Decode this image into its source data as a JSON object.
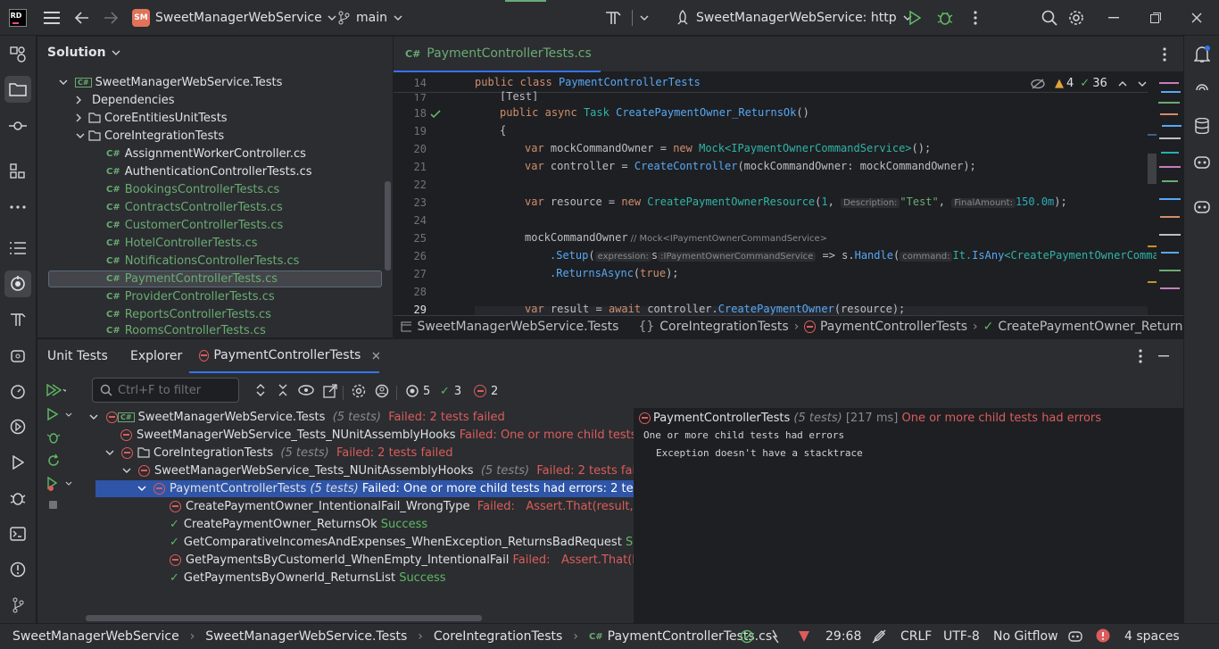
{
  "titlebar": {
    "logo": "RD",
    "project_badge": "SM",
    "project_name": "SweetManagerWebService",
    "branch": "main",
    "run_config": "SweetManagerWebService: http"
  },
  "solution": {
    "header": "Solution",
    "items": [
      {
        "label": "SweetManagerWebService.Tests",
        "lang": "C#"
      },
      {
        "label": "Dependencies"
      },
      {
        "label": "CoreEntitiesUnitTests"
      },
      {
        "label": "CoreIntegrationTests"
      },
      {
        "label": "AssignmentWorkerController.cs",
        "lang": "C#"
      },
      {
        "label": "AuthenticationControllerTests.cs",
        "lang": "C#"
      },
      {
        "label": "BookingsControllerTests.cs",
        "lang": "C#"
      },
      {
        "label": "ContractsControllerTests.cs",
        "lang": "C#"
      },
      {
        "label": "CustomerControllerTests.cs",
        "lang": "C#"
      },
      {
        "label": "HotelControllerTests.cs",
        "lang": "C#"
      },
      {
        "label": "NotificationsControllerTests.cs",
        "lang": "C#"
      },
      {
        "label": "PaymentControllerTests.cs",
        "lang": "C#"
      },
      {
        "label": "ProviderControllerTests.cs",
        "lang": "C#"
      },
      {
        "label": "ReportsControllerTests.cs",
        "lang": "C#"
      },
      {
        "label": "RoomsControllerTests.cs",
        "lang": "C#"
      }
    ]
  },
  "editor": {
    "tab_lang": "C#",
    "tab_label": "PaymentControllerTests.cs",
    "warnings": "4",
    "checks": "36",
    "sticky_line": "14",
    "lines": [
      "17",
      "18",
      "19",
      "20",
      "21",
      "22",
      "23",
      "24",
      "25",
      "26",
      "27",
      "28",
      "29"
    ],
    "code": {
      "sticky_public": "public",
      "sticky_class": "class",
      "sticky_name": "PaymentControllerTests",
      "l17": "[Test]",
      "l18_a": "public",
      "l18_b": "async",
      "l18_c": "Task",
      "l18_d": "CreatePaymentOwner_ReturnsOk",
      "l18_e": "()",
      "l19": "{",
      "l20_var": "var",
      "l20_name": " mockCommandOwner = ",
      "l20_new": "new",
      "l20_mock": " Mock",
      "l20_type": "<IPaymentOwnerCommandService>",
      "l20_end": "();",
      "l21_var": "var",
      "l21_name": " controller = ",
      "l21_fn": "CreateController",
      "l21_hint": "mockCommandOwner:",
      "l21_end": "mockCommandOwner);",
      "l23_var": "var",
      "l23_name": " resource = ",
      "l23_new": "new",
      "l23_type": " CreatePaymentOwnerResource",
      "l23_num1": "1",
      "l23_hint1": "Description:",
      "l23_str": "\"Test\"",
      "l23_hint2": "FinalAmount:",
      "l23_num2": "150.0m",
      "l23_end": ");",
      "l25_name": "mockCommandOwner",
      "l25_hint": "// Mock<IPaymentOwnerCommandService>",
      "l26_fn": ".Setup",
      "l26_hint1": "expression:",
      "l26_s": "s",
      "l26_hint2": ":IPaymentOwnerCommandService",
      "l26_arrow": " => s.",
      "l26_fn2": "Handle",
      "l26_hint3": "command:",
      "l26_it": "It.",
      "l26_isany": "IsAny",
      "l26_type": "<CreatePaymentOwnerCommand>",
      "l27_fn": ".ReturnsAsync",
      "l27_true": "true",
      "l27_end": ");",
      "l29_var": "var",
      "l29_name": " result = ",
      "l29_await": "await",
      "l29_ctrl": " controller.",
      "l29_fn": "CreatePaymentOwner",
      "l29_end": "(resource);"
    },
    "breadcrumb": [
      "SweetManagerWebService.Tests",
      "CoreIntegrationTests",
      "PaymentControllerTests",
      "CreatePaymentOwner_ReturnsOk"
    ]
  },
  "unit_tests": {
    "title": "Unit Tests",
    "tab_explorer": "Explorer",
    "tab_session": "PaymentControllerTests",
    "filter_placeholder": "Ctrl+F to filter",
    "count_total": "5",
    "count_passed": "3",
    "count_failed": "2",
    "tree": [
      {
        "name": "SweetManagerWebService.Tests",
        "lang": "C#",
        "meta": "(5 tests)",
        "status": "Failed: 2 tests failed"
      },
      {
        "name": "SweetManagerWebService_Tests_NUnitAssemblyHooks",
        "status": "Failed: One or more child tests h"
      },
      {
        "name": "CoreIntegrationTests",
        "meta": "(5 tests)",
        "status": "Failed: 2 tests failed"
      },
      {
        "name": "SweetManagerWebService_Tests_NUnitAssemblyHooks",
        "meta": "(5 tests)",
        "status": "Failed: 2 tests failed"
      },
      {
        "name": "PaymentControllerTests",
        "meta": "(5 tests)",
        "status": "Failed: One or more child tests had errors: 2 tests"
      },
      {
        "name": "CreatePaymentOwner_IntentionalFail_WrongType",
        "status": "Failed:",
        "detail": "Assert.That(result, Is."
      },
      {
        "name": "CreatePaymentOwner_ReturnsOk",
        "status": "Success"
      },
      {
        "name": "GetComparativeIncomesAndExpenses_WhenException_ReturnsBadRequest",
        "status": "Succ"
      },
      {
        "name": "GetPaymentsByCustomerId_WhenEmpty_IntentionalFail",
        "status": "Failed:",
        "detail": "Assert.That(list."
      },
      {
        "name": "GetPaymentsByOwnerId_ReturnsList",
        "status": "Success"
      }
    ],
    "detail": {
      "name": "PaymentControllerTests",
      "meta": "(5 tests)",
      "time": "[217 ms]",
      "status": "One or more child tests had errors",
      "line1": "One or more child tests had errors",
      "line2": "Exception doesn't have a stacktrace"
    }
  },
  "statusbar": {
    "crumbs": [
      "SweetManagerWebService",
      "SweetManagerWebService.Tests",
      "CoreIntegrationTests"
    ],
    "file_lang": "C#",
    "file": "PaymentControllerTests.cs",
    "position": "29:68",
    "line_ending": "CRLF",
    "encoding": "UTF-8",
    "vcs": "No Gitflow",
    "indent": "4 spaces"
  },
  "colors": {
    "accent": "#3574f0",
    "fail": "#db5c5c",
    "success": "#5fb865",
    "cs_file": "#6aab73"
  }
}
